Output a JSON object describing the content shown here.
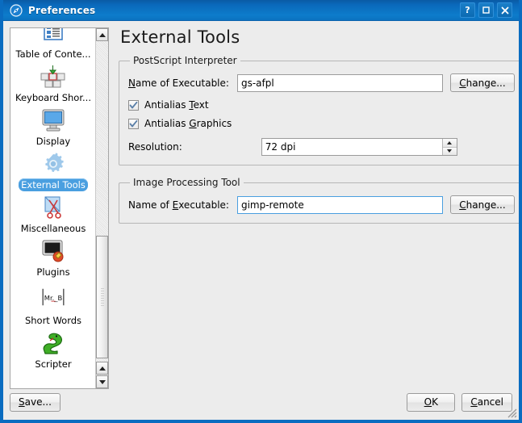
{
  "window": {
    "title": "Preferences",
    "icon": "application-icon",
    "controls": [
      {
        "name": "help-button",
        "label": "?"
      },
      {
        "name": "maximize-button",
        "label": "□"
      },
      {
        "name": "close-button",
        "label": "✕"
      }
    ]
  },
  "sidebar": {
    "items": [
      {
        "label": "Table of Conte...",
        "icon": "table-of-contents-icon",
        "selected": false
      },
      {
        "label": "Keyboard Shor...",
        "icon": "keyboard-shortcuts-icon",
        "selected": false
      },
      {
        "label": "Display",
        "icon": "display-monitor-icon",
        "selected": false
      },
      {
        "label": "External Tools",
        "icon": "gear-icon",
        "selected": true
      },
      {
        "label": "Miscellaneous",
        "icon": "scissors-icon",
        "selected": false
      },
      {
        "label": "Plugins",
        "icon": "plugins-icon",
        "selected": false
      },
      {
        "label": "Short Words",
        "icon": "short-words-icon",
        "icon_text": "Mr._B",
        "selected": false
      },
      {
        "label": "Scripter",
        "icon": "python-snake-icon",
        "selected": false
      }
    ]
  },
  "main": {
    "title": "External Tools",
    "groups": [
      {
        "legend": "PostScript Interpreter",
        "executable_label_pre": "",
        "executable_label_mnemonic": "N",
        "executable_label_post": "ame of Executable:",
        "executable_value": "gs-afpl",
        "executable_placeholder": "",
        "change_label_mnemonic": "C",
        "change_label_post": "hange...",
        "checkboxes": [
          {
            "pre": "Antialias ",
            "mnemonic": "T",
            "post": "ext",
            "checked": true
          },
          {
            "pre": "Antialias ",
            "mnemonic": "G",
            "post": "raphics",
            "checked": true
          }
        ],
        "resolution_label": "Resolution:",
        "resolution_value": "72 dpi"
      },
      {
        "legend": "Image Processing Tool",
        "executable_label_pre": "Name of ",
        "executable_label_mnemonic": "E",
        "executable_label_post": "xecutable:",
        "executable_value": "gimp-remote",
        "executable_placeholder": "",
        "change_label_mnemonic": "C",
        "change_label_post": "hange...",
        "focused": true
      }
    ]
  },
  "footer": {
    "save_mnemonic": "S",
    "save_post": "ave...",
    "ok_mnemonic": "O",
    "ok_post": "K",
    "cancel_mnemonic": "C",
    "cancel_post": "ancel"
  },
  "colors": {
    "titlebar_start": "#0a5ba4",
    "titlebar_end": "#0d7ccb",
    "window_border": "#0a6cc0",
    "selection": "#4a9fe0",
    "face": "#ececec"
  }
}
